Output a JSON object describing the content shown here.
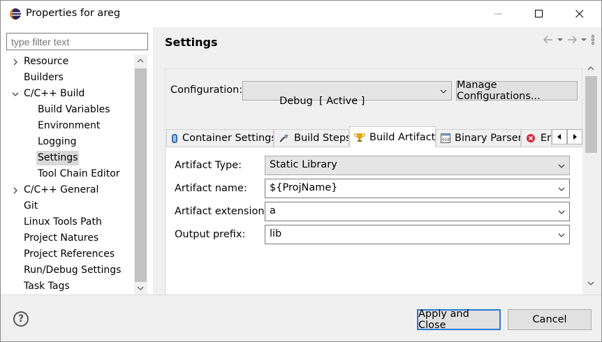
{
  "window": {
    "title": "Properties for areg",
    "colors": {
      "title_bg": "#ffffff",
      "panel_bg": "#f0f0f0",
      "focus_border": "#2a79d8",
      "selection": "#d9d9d9"
    }
  },
  "sidebar": {
    "filter_placeholder": "type filter text",
    "items": [
      {
        "label": "Resource",
        "level": 0,
        "expander": "collapsed"
      },
      {
        "label": "Builders",
        "level": 0,
        "expander": "none"
      },
      {
        "label": "C/C++ Build",
        "level": 0,
        "expander": "expanded"
      },
      {
        "label": "Build Variables",
        "level": 1,
        "expander": "none"
      },
      {
        "label": "Environment",
        "level": 1,
        "expander": "none"
      },
      {
        "label": "Logging",
        "level": 1,
        "expander": "none"
      },
      {
        "label": "Settings",
        "level": 1,
        "expander": "none",
        "selected": true
      },
      {
        "label": "Tool Chain Editor",
        "level": 1,
        "expander": "none"
      },
      {
        "label": "C/C++ General",
        "level": 0,
        "expander": "collapsed"
      },
      {
        "label": "Git",
        "level": 0,
        "expander": "none"
      },
      {
        "label": "Linux Tools Path",
        "level": 0,
        "expander": "none"
      },
      {
        "label": "Project Natures",
        "level": 0,
        "expander": "none"
      },
      {
        "label": "Project References",
        "level": 0,
        "expander": "none"
      },
      {
        "label": "Run/Debug Settings",
        "level": 0,
        "expander": "none"
      },
      {
        "label": "Task Tags",
        "level": 0,
        "expander": "none"
      }
    ]
  },
  "main": {
    "title": "Settings",
    "configuration": {
      "label": "Configuration:",
      "value": "Debug  [ Active ]",
      "manage_button": "Manage Configurations..."
    },
    "tabs": [
      {
        "label": "Container Settings",
        "icon": "container-icon"
      },
      {
        "label": "Build Steps",
        "icon": "build-steps-icon"
      },
      {
        "label": "Build Artifact",
        "icon": "trophy-icon",
        "active": true
      },
      {
        "label": "Binary Parsers",
        "icon": "binary-icon"
      },
      {
        "label": "Er",
        "icon": "error-icon"
      }
    ],
    "artifact": {
      "type_label": "Artifact Type:",
      "type_value": "Static Library",
      "name_label": "Artifact name:",
      "name_value": "${ProjName}",
      "extension_label": "Artifact extension:",
      "extension_value": "a",
      "prefix_label": "Output prefix:",
      "prefix_value": "lib"
    }
  },
  "footer": {
    "help_symbol": "?",
    "apply_button": "Apply and Close",
    "cancel_button": "Cancel"
  }
}
